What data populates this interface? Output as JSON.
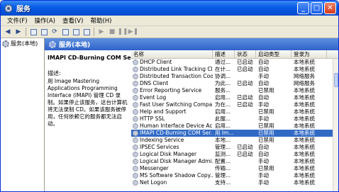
{
  "window": {
    "title": "服务"
  },
  "menu": [
    "文件(F)",
    "操作(A)",
    "查看(V)",
    "帮助(H)"
  ],
  "tree": {
    "root_label": "服务(本地)"
  },
  "content": {
    "header": "服务(本地)",
    "selected_service": {
      "name": "IMAPI CD-Burning COM Service",
      "description_label": "描述:",
      "description": "用 Image Mastering Applications Programming Interface (IMAPI) 管理 CD 录制。如果停止该服务，这台计算机将无法录制 CD。如果该服务被停用，任何依赖它的服务都无法启动。"
    }
  },
  "columns": [
    "名称",
    "描述",
    "状态",
    "启动类型",
    "登录为"
  ],
  "services": [
    {
      "name": "DHCP Client",
      "desc": "通过...",
      "state": "已启动",
      "start": "自动",
      "logon": "本地系统"
    },
    {
      "name": "Distributed Link Tracking Cli...",
      "desc": "在计...",
      "state": "已启动",
      "start": "自动",
      "logon": "本地系统"
    },
    {
      "name": "Distributed Transaction Coo...",
      "desc": "协调...",
      "state": "",
      "start": "手动",
      "logon": "网络服务"
    },
    {
      "name": "DNS Client",
      "desc": "为此...",
      "state": "已启动",
      "start": "自动",
      "logon": "网络服务"
    },
    {
      "name": "Error Reporting Service",
      "desc": "服务...",
      "state": "",
      "start": "已禁用",
      "logon": "本地系统"
    },
    {
      "name": "Event Log",
      "desc": "启用...",
      "state": "已启动",
      "start": "自动",
      "logon": "本地系统"
    },
    {
      "name": "Fast User Switching Compa...",
      "desc": "为在...",
      "state": "已启动",
      "start": "手动",
      "logon": "本地系统"
    },
    {
      "name": "Help and Support",
      "desc": "启用...",
      "state": "",
      "start": "已禁用",
      "logon": "本地系统"
    },
    {
      "name": "HTTP SSL",
      "desc": "此服...",
      "state": "",
      "start": "手动",
      "logon": "本地系统"
    },
    {
      "name": "Human Interface Device Ac...",
      "desc": "启用...",
      "state": "",
      "start": "已禁用",
      "logon": "本地系统"
    },
    {
      "name": "IMAPI CD-Burning COM Ser...",
      "desc": "用 Im...",
      "state": "",
      "start": "已禁用",
      "logon": "本地系统",
      "selected": true
    },
    {
      "name": "Indexing Service",
      "desc": "本地...",
      "state": "",
      "start": "已禁用",
      "logon": "本地系统"
    },
    {
      "name": "IPSEC Services",
      "desc": "管理...",
      "state": "已启动",
      "start": "自动",
      "logon": "本地系统"
    },
    {
      "name": "Logical Disk Manager",
      "desc": "监测...",
      "state": "已启动",
      "start": "自动",
      "logon": "本地系统"
    },
    {
      "name": "Logical Disk Manager Admi...",
      "desc": "配置...",
      "state": "",
      "start": "手动",
      "logon": "本地系统"
    },
    {
      "name": "Messenger",
      "desc": "传输...",
      "state": "",
      "start": "已禁用",
      "logon": "本地系统"
    },
    {
      "name": "MS Software Shadow Copy...",
      "desc": "管理...",
      "state": "",
      "start": "手动",
      "logon": "本地系统"
    },
    {
      "name": "Net Logon",
      "desc": "支持...",
      "state": "",
      "start": "手动",
      "logon": "本地系统"
    }
  ]
}
